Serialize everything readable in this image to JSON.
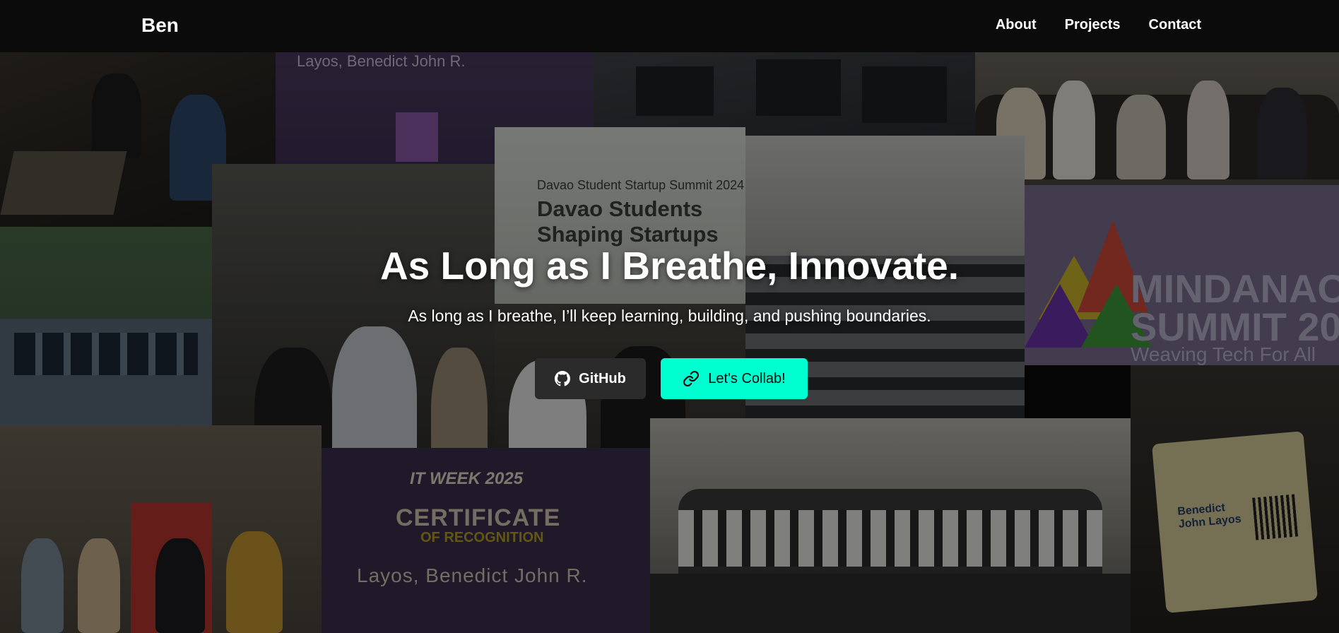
{
  "nav": {
    "brand": "Ben",
    "links": [
      "About",
      "Projects",
      "Contact"
    ]
  },
  "hero": {
    "title": "As Long as I Breathe, Innovate.",
    "subtitle": "As long as I breathe, I’ll keep learning, building, and pushing boundaries.",
    "buttons": {
      "github": "GitHub",
      "collab": "Let's Collab!"
    }
  },
  "background": {
    "summit_title": "MINDANAO SUMMIT 20",
    "summit_sub": "Weaving Tech For All",
    "banner_top": "Davao Student Startup Summit 2024",
    "banner_title": "Davao Students Shaping Startups",
    "cert_week": "IT WEEK 2025",
    "cert_title": "CERTIFICATE",
    "cert_sub": "OF RECOGNITION",
    "cert_name": "Layos, Benedict John R.",
    "badge_name": "Benedict John Layos"
  },
  "colors": {
    "nav_bg": "#0b0b0b",
    "accent": "#00ffd0",
    "github_button": "#2b2b2b"
  },
  "icons": [
    "github-icon",
    "link-icon"
  ]
}
